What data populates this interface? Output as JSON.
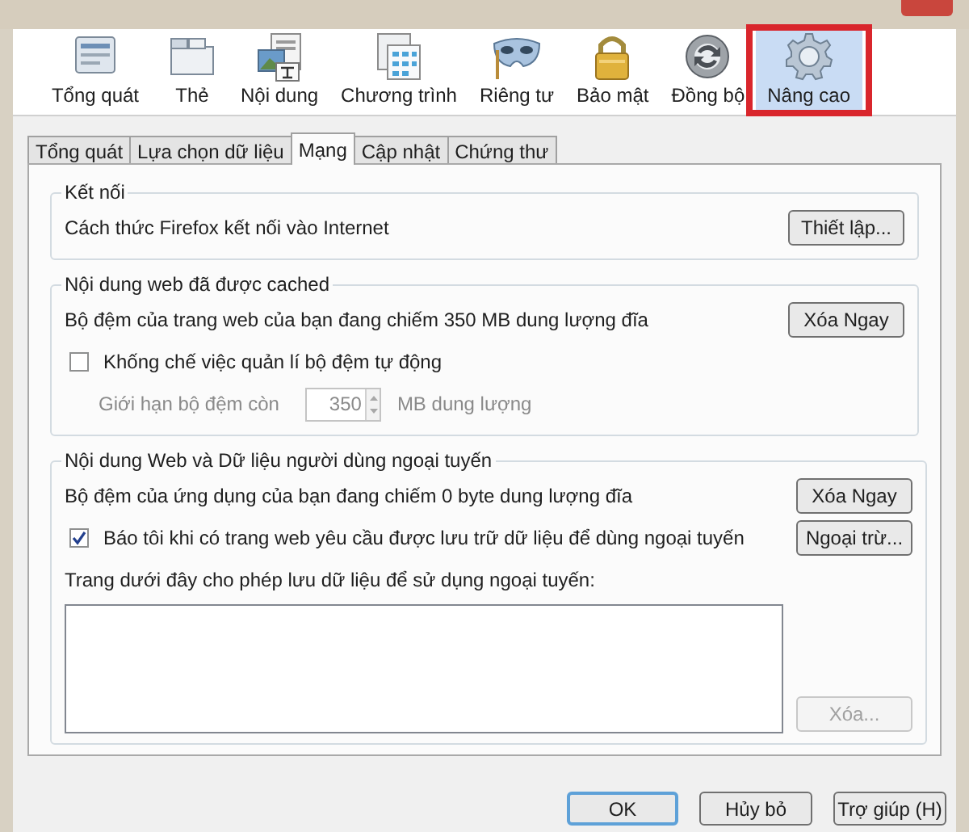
{
  "toolbar": [
    {
      "label": "Tổng quát",
      "selected": false
    },
    {
      "label": "Thẻ",
      "selected": false
    },
    {
      "label": "Nội dung",
      "selected": false
    },
    {
      "label": "Chương trình",
      "selected": false
    },
    {
      "label": "Riêng tư",
      "selected": false
    },
    {
      "label": "Bảo mật",
      "selected": false
    },
    {
      "label": "Đồng bộ",
      "selected": false
    },
    {
      "label": "Nâng cao",
      "selected": true
    }
  ],
  "subtabs": [
    {
      "label": "Tổng quát",
      "selected": false
    },
    {
      "label": "Lựa chọn dữ liệu",
      "selected": false
    },
    {
      "label": "Mạng",
      "selected": true
    },
    {
      "label": "Cập nhật",
      "selected": false
    },
    {
      "label": "Chứng thư",
      "selected": false
    }
  ],
  "sections": [
    {
      "title": "Kết nối",
      "rows": [
        {
          "kind": "text_button",
          "text": "Cách thức Firefox kết nối vào Internet",
          "button": {
            "label": "Thiết lập...",
            "disabled": false
          }
        }
      ]
    },
    {
      "title": "Nội dung web đã được cached",
      "rows": [
        {
          "kind": "text_button",
          "text": "Bộ đệm của trang web của bạn đang chiếm 350 MB dung lượng đĩa",
          "button": {
            "label": "Xóa Ngay",
            "disabled": false
          }
        },
        {
          "kind": "checkbox",
          "label": "Khống chế việc quản lí bộ đệm tự động",
          "checked": false
        },
        {
          "kind": "spin",
          "label": "Giới hạn bộ đệm còn",
          "value": "350",
          "unit": "MB dung lượng",
          "disabled": true
        }
      ]
    },
    {
      "title": "Nội dung Web và Dữ liệu người dùng ngoại tuyến",
      "rows": [
        {
          "kind": "text_button",
          "text": "Bộ đệm của ứng dụng của bạn đang chiếm 0 byte dung lượng đĩa",
          "button": {
            "label": "Xóa Ngay",
            "disabled": false
          }
        },
        {
          "kind": "checkbox",
          "label": "Báo tôi khi có trang web yêu cầu được lưu trữ dữ liệu để dùng ngoại tuyến",
          "checked": true,
          "button": {
            "label": "Ngoại trừ...",
            "disabled": false
          }
        },
        {
          "kind": "label",
          "text": "Trang dưới đây cho phép lưu dữ liệu để sử dụng ngoại tuyến:"
        },
        {
          "kind": "listbox",
          "button": {
            "label": "Xóa...",
            "disabled": true
          }
        }
      ]
    }
  ],
  "footer": [
    {
      "label": "OK",
      "default": true
    },
    {
      "label": "Hủy bỏ",
      "default": false
    },
    {
      "label": "Trợ giúp (H)",
      "default": false
    }
  ]
}
